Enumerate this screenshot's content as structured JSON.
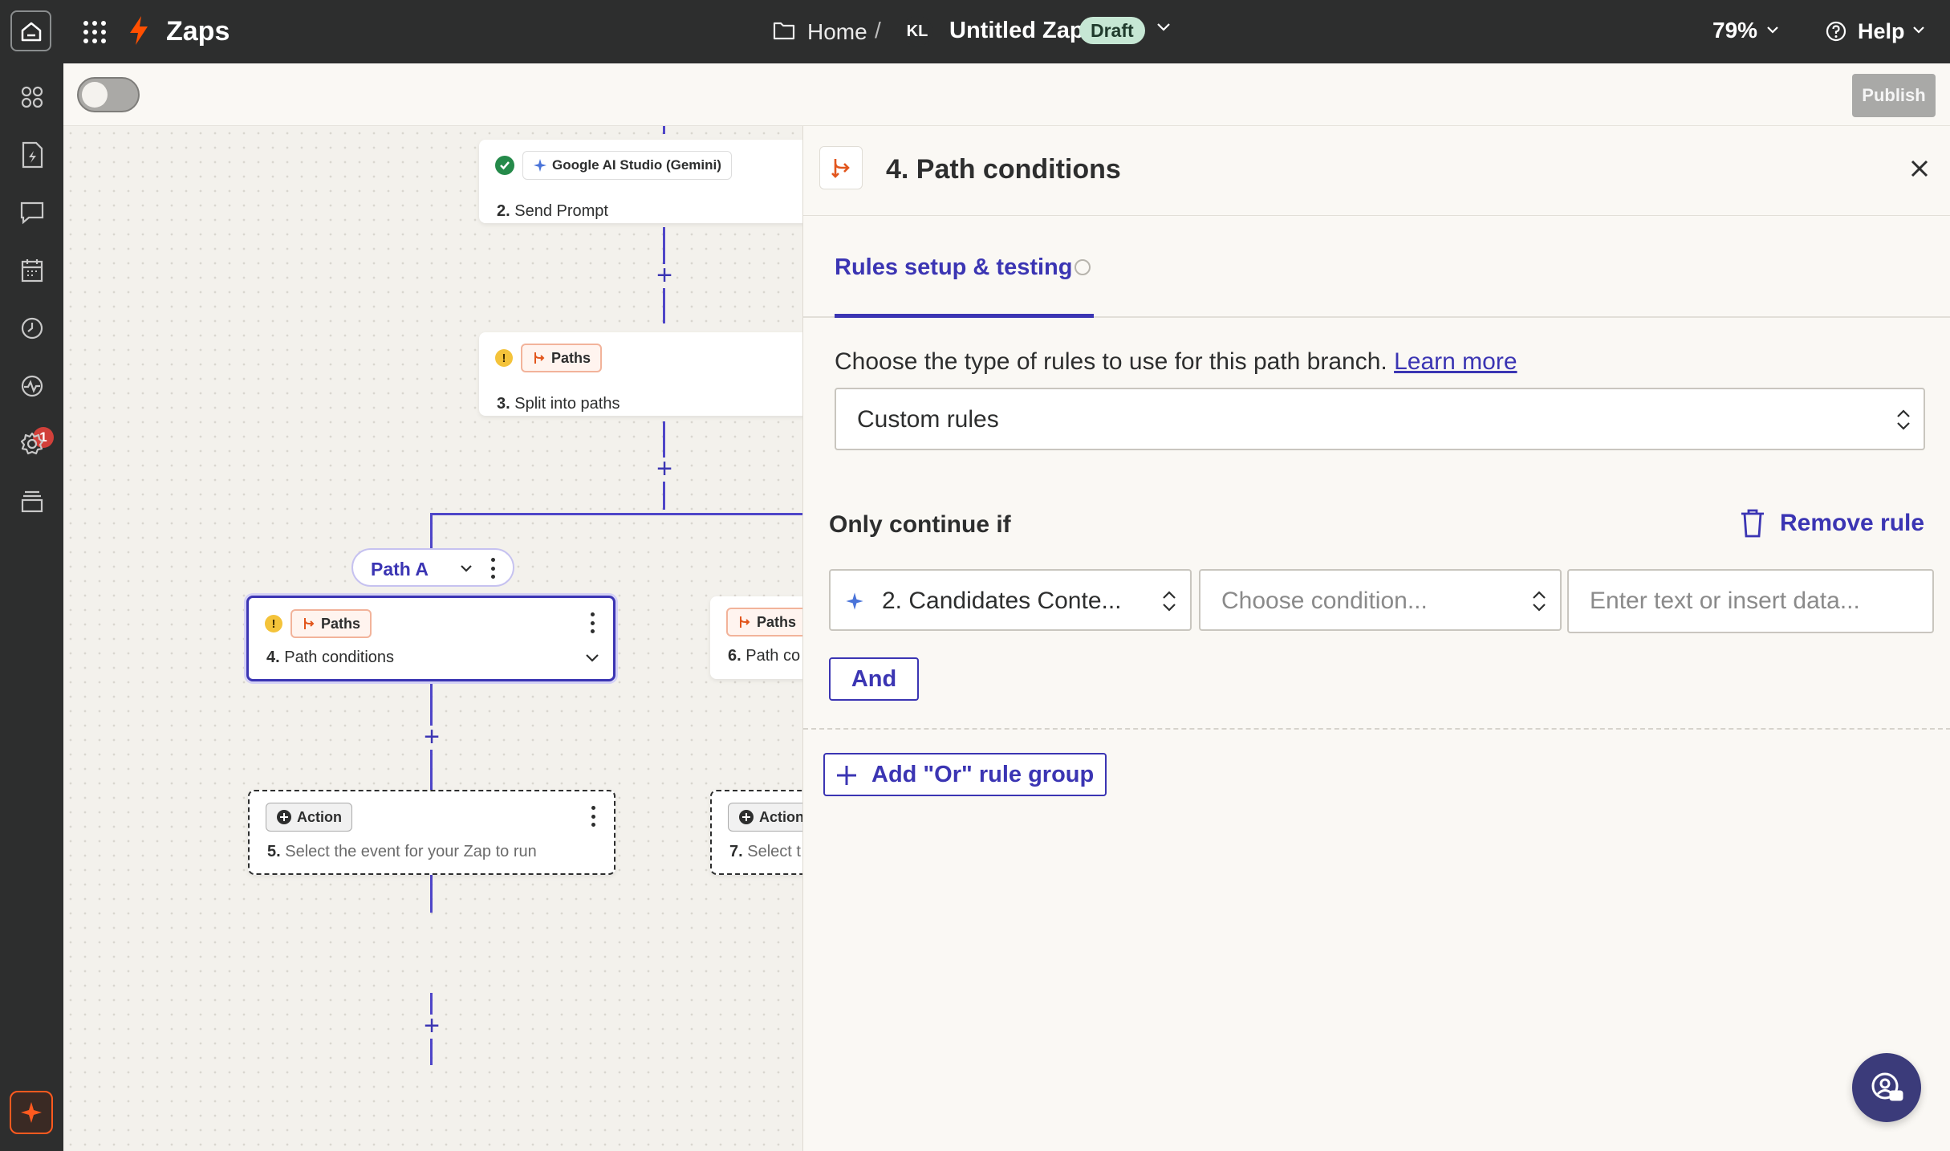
{
  "topbar": {
    "app_name": "Zaps",
    "breadcrumb_home": "Home",
    "breadcrumb_separator": "/",
    "avatar_initials": "KL",
    "zap_title": "Untitled Zap",
    "status_badge": "Draft",
    "zoom": "79%",
    "help": "Help"
  },
  "rail": {
    "notification_count": "1",
    "icons": [
      "grid-icon",
      "zap-file-icon",
      "chat-icon",
      "calendar-icon",
      "history-icon",
      "activity-icon",
      "settings-icon",
      "archive-icon",
      "copilot-sparkle-icon"
    ]
  },
  "toolbar": {
    "publish_label": "Publish"
  },
  "canvas": {
    "step2": {
      "app": "Google AI Studio (Gemini)",
      "number": "2.",
      "label": "Send Prompt"
    },
    "step3": {
      "tag": "Paths",
      "number": "3.",
      "label": "Split into paths"
    },
    "path_a": {
      "label": "Path A"
    },
    "step4": {
      "tag": "Paths",
      "number": "4.",
      "label": "Path conditions"
    },
    "step5": {
      "tag": "Action",
      "number": "5.",
      "label": "Select the event for your Zap to run"
    },
    "step6": {
      "tag": "Paths",
      "number": "6.",
      "label": "Path co"
    },
    "step7": {
      "tag": "Action",
      "number": "7.",
      "label": "Select t"
    }
  },
  "panel": {
    "title": "4. Path conditions",
    "tab_label": "Rules setup & testing",
    "description": "Choose the type of rules to use for this path branch.",
    "learn_more": "Learn more",
    "rule_type_value": "Custom rules",
    "only_continue_label": "Only continue if",
    "remove_rule_label": "Remove rule",
    "field_value": "2. Candidates Conte...",
    "condition_placeholder": "Choose condition...",
    "value_placeholder": "Enter text or insert data...",
    "and_label": "And",
    "or_group_label": "Add \"Or\" rule group"
  },
  "colors": {
    "accent": "#3b35b3",
    "brand_orange": "#ff4f00",
    "topbar_bg": "#2d2e2e",
    "draft_badge": "#c6e7d4"
  }
}
